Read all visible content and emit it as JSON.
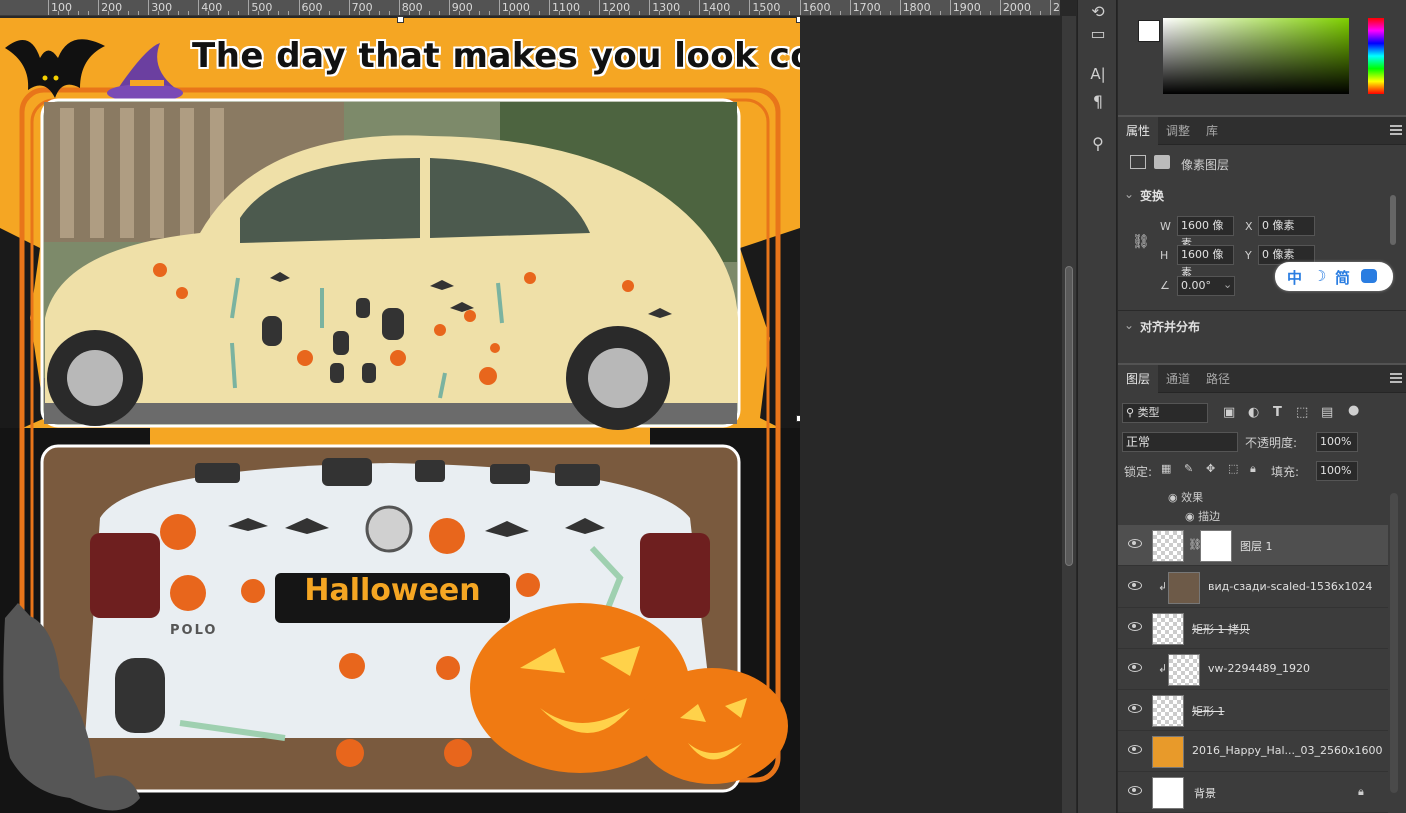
{
  "ruler": {
    "labels": [
      "100",
      "200",
      "300",
      "400",
      "500",
      "600",
      "700",
      "800",
      "900",
      "1000",
      "1100",
      "1200",
      "1300",
      "1400",
      "1500",
      "1600",
      "1700",
      "1800",
      "1900",
      "2000",
      "2"
    ]
  },
  "canvas": {
    "headline": "The day that makes you look cool",
    "plate_text": "Halloween",
    "polo_text": "POLO",
    "colors": {
      "background": "#f5a623",
      "frame": "#e8751a",
      "dark": "#111111"
    }
  },
  "toolbar": {
    "icons": [
      "history-icon",
      "comment-icon",
      "character-icon",
      "paragraph-icon",
      "hand-tool-icon"
    ]
  },
  "color_panel": {
    "foreground": "#ffffff",
    "background": "#ffffff",
    "hue": "#7fd000"
  },
  "properties": {
    "tabs": [
      "属性",
      "调整",
      "库"
    ],
    "active_tab": "属性",
    "layer_type": "像素图层",
    "transform_title": "变换",
    "w_label": "W",
    "w_value": "1600 像素",
    "x_label": "X",
    "x_value": "0 像素",
    "h_label": "H",
    "h_value": "1600 像素",
    "y_label": "Y",
    "y_value": "0 像素",
    "angle_value": "0.00°",
    "align_title": "对齐并分布",
    "ime": {
      "chinese": "中",
      "moon": "☽",
      "simplified": "简"
    }
  },
  "layers_panel": {
    "tabs": [
      "图层",
      "通道",
      "路径"
    ],
    "active_tab": "图层",
    "filter": "类型",
    "blend_mode": "正常",
    "opacity_label": "不透明度:",
    "opacity_value": "100%",
    "lock_label": "锁定:",
    "fill_label": "填充:",
    "fill_value": "100%",
    "effects_label": "效果",
    "stroke_label": "描边",
    "layers": [
      {
        "name": "图层 1",
        "selected": true,
        "strike": false
      },
      {
        "name": "вид-сзади-scaled-1536x1024",
        "selected": false,
        "strike": false
      },
      {
        "name": "矩形 1 拷贝",
        "selected": false,
        "strike": true
      },
      {
        "name": "vw-2294489_1920",
        "selected": false,
        "strike": false
      },
      {
        "name": "矩形 1",
        "selected": false,
        "strike": true
      },
      {
        "name": "2016_Happy_Hal..._03_2560x1600",
        "selected": false,
        "strike": false
      },
      {
        "name": "背景",
        "selected": false,
        "strike": false
      }
    ]
  }
}
